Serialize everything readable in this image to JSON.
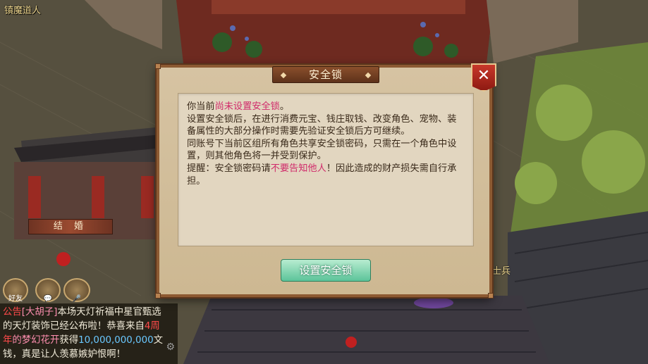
{
  "scene": {
    "npc_name": "镇魔道人",
    "marry_sign": "结 婚",
    "soldier_label": "士兵",
    "hud_buttons": [
      {
        "label": "好友"
      },
      {
        "label": ""
      },
      {
        "label": "[处"
      }
    ]
  },
  "chat": {
    "line1_tag": "公告",
    "line1_player": "[大胡子]",
    "line1_text": "本场天灯祈福中星官甄选",
    "line2_text_a": "的天灯装饰已经公布啦！恭喜来自",
    "line2_highlight": "4周",
    "line3_highlight": "年",
    "line3_player": "的梦幻花开",
    "line3_text": "获得",
    "line3_amount": "10,000,000,000",
    "line3_unit": "文",
    "line4_text": "钱，真是让人羡慕嫉妒恨啊！"
  },
  "dialog": {
    "title": "安全锁",
    "close_label": "✕",
    "p1_a": "你当前",
    "p1_hl": "尚未设置安全锁",
    "p1_b": "。",
    "p2": "设置安全锁后，在进行消费元宝、钱庄取钱、改变角色、宠物、装备属性的大部分操作时需要先验证安全锁后方可继续。",
    "p3": "同账号下当前区组所有角色共享安全锁密码，只需在一个角色中设置，则其他角色将一并受到保护。",
    "p4_a": "提醒：安全锁密码请",
    "p4_hl": "不要告知他人",
    "p4_b": "！因此造成的财产损失需自行承担。",
    "button_label": "设置安全锁"
  },
  "colors": {
    "highlight": "#d02a6a",
    "button": "#5cc49a",
    "frame": "#8c5a32",
    "close": "#c8382a"
  }
}
